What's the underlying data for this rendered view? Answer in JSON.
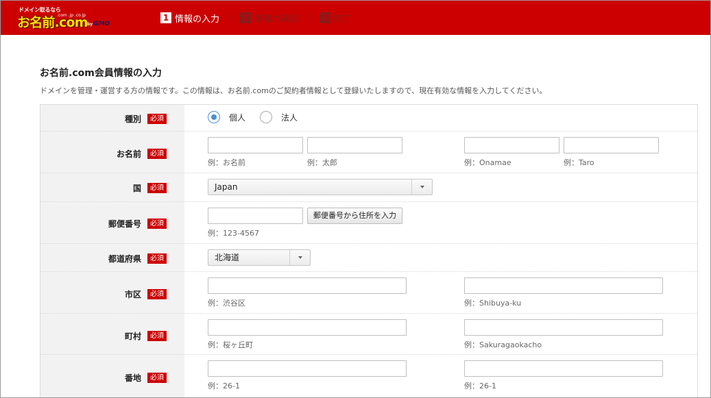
{
  "header": {
    "logo": {
      "tagline": "ドメイン取るなら",
      "name": "お名前.com",
      "tlds": ".com .jp .co.jp",
      "by": "by",
      "company": "GMO"
    },
    "steps": [
      {
        "num": "1",
        "label": "情報の入力",
        "active": true
      },
      {
        "num": "2",
        "label": "情報の確認",
        "active": false
      },
      {
        "num": "3",
        "label": "完了",
        "active": false
      }
    ],
    "colors": {
      "brand": "#cc0000",
      "logo": "#ffe100"
    }
  },
  "page": {
    "title": "お名前.com会員情報の入力",
    "description": "ドメインを管理・運営する方の情報です。この情報は、お名前.comのご契約者情報として登録いたしますので、現在有効な情報を入力してください。"
  },
  "form": {
    "required_label": "必須",
    "type": {
      "label": "種別",
      "options": [
        "個人",
        "法人"
      ],
      "selected": "個人"
    },
    "name": {
      "label": "お名前",
      "hints": [
        "例：お名前",
        "例：太郎",
        "例：Onamae",
        "例：Taro"
      ]
    },
    "country": {
      "label": "国",
      "value": "Japan"
    },
    "postal": {
      "label": "郵便番号",
      "button": "郵便番号から住所を入力",
      "hint": "例：123-4567"
    },
    "prefecture": {
      "label": "都道府県",
      "value": "北海道"
    },
    "city": {
      "label": "市区",
      "hints": [
        "例：渋谷区",
        "例：Shibuya-ku"
      ]
    },
    "town": {
      "label": "町村",
      "hints": [
        "例：桜ヶ丘町",
        "例：Sakuragaokacho"
      ]
    },
    "address": {
      "label": "番地",
      "hints": [
        "例：26-1",
        "例：26-1"
      ]
    }
  }
}
